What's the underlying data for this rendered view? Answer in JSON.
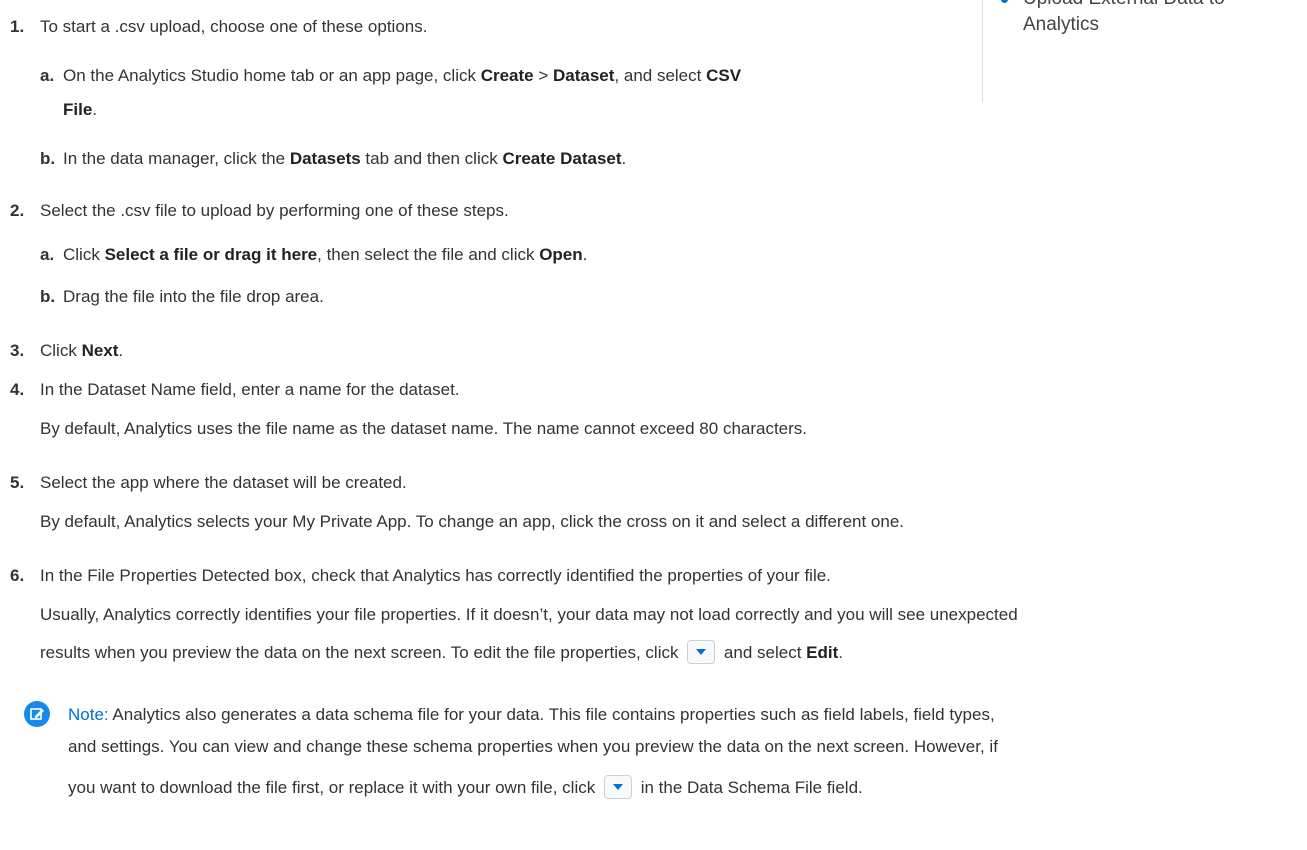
{
  "sidebar": {
    "item_line1": "Upload External Data to",
    "item_line2": "Analytics"
  },
  "steps": {
    "s1": {
      "num": "1.",
      "text": "To start a .csv upload, choose one of these options.",
      "a": {
        "num": "a.",
        "t1": "On the Analytics Studio home tab or an app page, click ",
        "b1": "Create",
        "t2": " > ",
        "b2": "Dataset",
        "t3": ", and select ",
        "b3": "CSV",
        "b4": "File",
        "t4": "."
      },
      "b": {
        "num": "b.",
        "t1": "In the data manager, click the ",
        "b1": "Datasets",
        "t2": " tab and then click ",
        "b2": "Create Dataset",
        "t3": "."
      }
    },
    "s2": {
      "num": "2.",
      "text": "Select the .csv file to upload by performing one of these steps.",
      "a": {
        "num": "a.",
        "t1": "Click ",
        "b1": "Select a file or drag it here",
        "t2": ", then select the file and click ",
        "b2": "Open",
        "t3": "."
      },
      "b": {
        "num": "b.",
        "text": "Drag the file into the file drop area."
      }
    },
    "s3": {
      "num": "3.",
      "t1": "Click ",
      "b1": "Next",
      "t2": "."
    },
    "s4": {
      "num": "4.",
      "text": "In the Dataset Name field, enter a name for the dataset.",
      "detail": "By default, Analytics uses the file name as the dataset name. The name cannot exceed 80 characters."
    },
    "s5": {
      "num": "5.",
      "text": "Select the app where the dataset will be created.",
      "detail": "By default, Analytics selects your My Private App. To change an app, click the cross on it and select a different one."
    },
    "s6": {
      "num": "6.",
      "text": "In the File Properties Detected box, check that Analytics has correctly identified the properties of your file.",
      "detail1": "Usually, Analytics correctly identifies your file properties. If it doesn’t, your data may not load correctly and you will see unexpected",
      "detail2_t1": "results when you preview the data on the next screen. To edit the file properties, click ",
      "detail2_t2": " and select ",
      "detail2_b1": "Edit",
      "detail2_t3": "."
    }
  },
  "note": {
    "label": "Note:",
    "line1": " Analytics also generates a data schema file for your data. This file contains properties such as field labels, field types,",
    "line2": "and settings. You can view and change these schema properties when you preview the data on the next screen. However, if",
    "line3_t1": "you want to download the file first, or replace it with your own file, click ",
    "line3_t2": " in the Data Schema File field."
  },
  "icons": {
    "note": "edit-note-icon",
    "dropdown": "dropdown-arrow-icon"
  },
  "colors": {
    "accent": "#0070d2",
    "note_icon": "#1589ee"
  }
}
